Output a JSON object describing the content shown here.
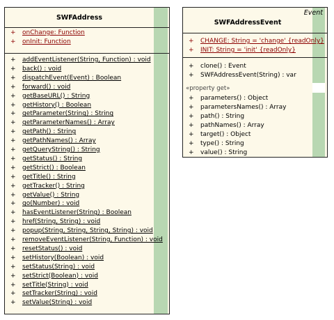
{
  "classes": [
    {
      "name": "SWFAddress",
      "attributes": [
        {
          "vis": "+",
          "text": "onChange:  Function"
        },
        {
          "vis": "+",
          "text": "onInit:  Function"
        }
      ],
      "operations": [
        {
          "vis": "+",
          "text": "addEventListener(String, Function) : void"
        },
        {
          "vis": "+",
          "text": "back() : void"
        },
        {
          "vis": "+",
          "text": "dispatchEvent(Event) : Boolean"
        },
        {
          "vis": "+",
          "text": "forward() : void"
        },
        {
          "vis": "+",
          "text": "getBaseURL() : String"
        },
        {
          "vis": "+",
          "text": "getHistory() : Boolean"
        },
        {
          "vis": "+",
          "text": "getParameter(String) : String"
        },
        {
          "vis": "+",
          "text": "getParameterNames() : Array"
        },
        {
          "vis": "+",
          "text": "getPath() : String"
        },
        {
          "vis": "+",
          "text": "getPathNames() : Array"
        },
        {
          "vis": "+",
          "text": "getQueryString() : String"
        },
        {
          "vis": "+",
          "text": "getStatus() : String"
        },
        {
          "vis": "+",
          "text": "getStrict() : Boolean"
        },
        {
          "vis": "+",
          "text": "getTitle() : String"
        },
        {
          "vis": "+",
          "text": "getTracker() : String"
        },
        {
          "vis": "+",
          "text": "getValue() : String"
        },
        {
          "vis": "+",
          "text": "go(Number) : void"
        },
        {
          "vis": "+",
          "text": "hasEventListener(String) : Boolean"
        },
        {
          "vis": "+",
          "text": "href(String, String) : void"
        },
        {
          "vis": "+",
          "text": "popup(String, String, String, String) : void"
        },
        {
          "vis": "+",
          "text": "removeEventListener(String, Function) : void"
        },
        {
          "vis": "+",
          "text": "resetStatus() : void"
        },
        {
          "vis": "+",
          "text": "setHistory(Boolean) : void"
        },
        {
          "vis": "+",
          "text": "setStatus(String) : void"
        },
        {
          "vis": "+",
          "text": "setStrict(Boolean) : void"
        },
        {
          "vis": "+",
          "text": "setTitle(String) : void"
        },
        {
          "vis": "+",
          "text": "setTracker(String) : void"
        },
        {
          "vis": "+",
          "text": "setValue(String) : void"
        }
      ]
    },
    {
      "name": "SWFAddressEvent",
      "stereotype": "Event",
      "attributes": [
        {
          "vis": "+",
          "text": "CHANGE:  String = 'change' {readOnly}"
        },
        {
          "vis": "+",
          "text": "INIT:  String = 'init' {readOnly}"
        }
      ],
      "operations": [
        {
          "vis": "+",
          "text": "clone() : Event"
        },
        {
          "vis": "+",
          "text": "SWFAddressEvent(String) : var"
        }
      ],
      "section_label": "«property get»",
      "property_ops": [
        {
          "vis": "+",
          "text": "parameters() : Object"
        },
        {
          "vis": "+",
          "text": "parametersNames() : Array"
        },
        {
          "vis": "+",
          "text": "path() : String"
        },
        {
          "vis": "+",
          "text": "pathNames() : Array"
        },
        {
          "vis": "+",
          "text": "target() : Object"
        },
        {
          "vis": "+",
          "text": "type() : String"
        },
        {
          "vis": "+",
          "text": "value() : String"
        }
      ]
    }
  ]
}
